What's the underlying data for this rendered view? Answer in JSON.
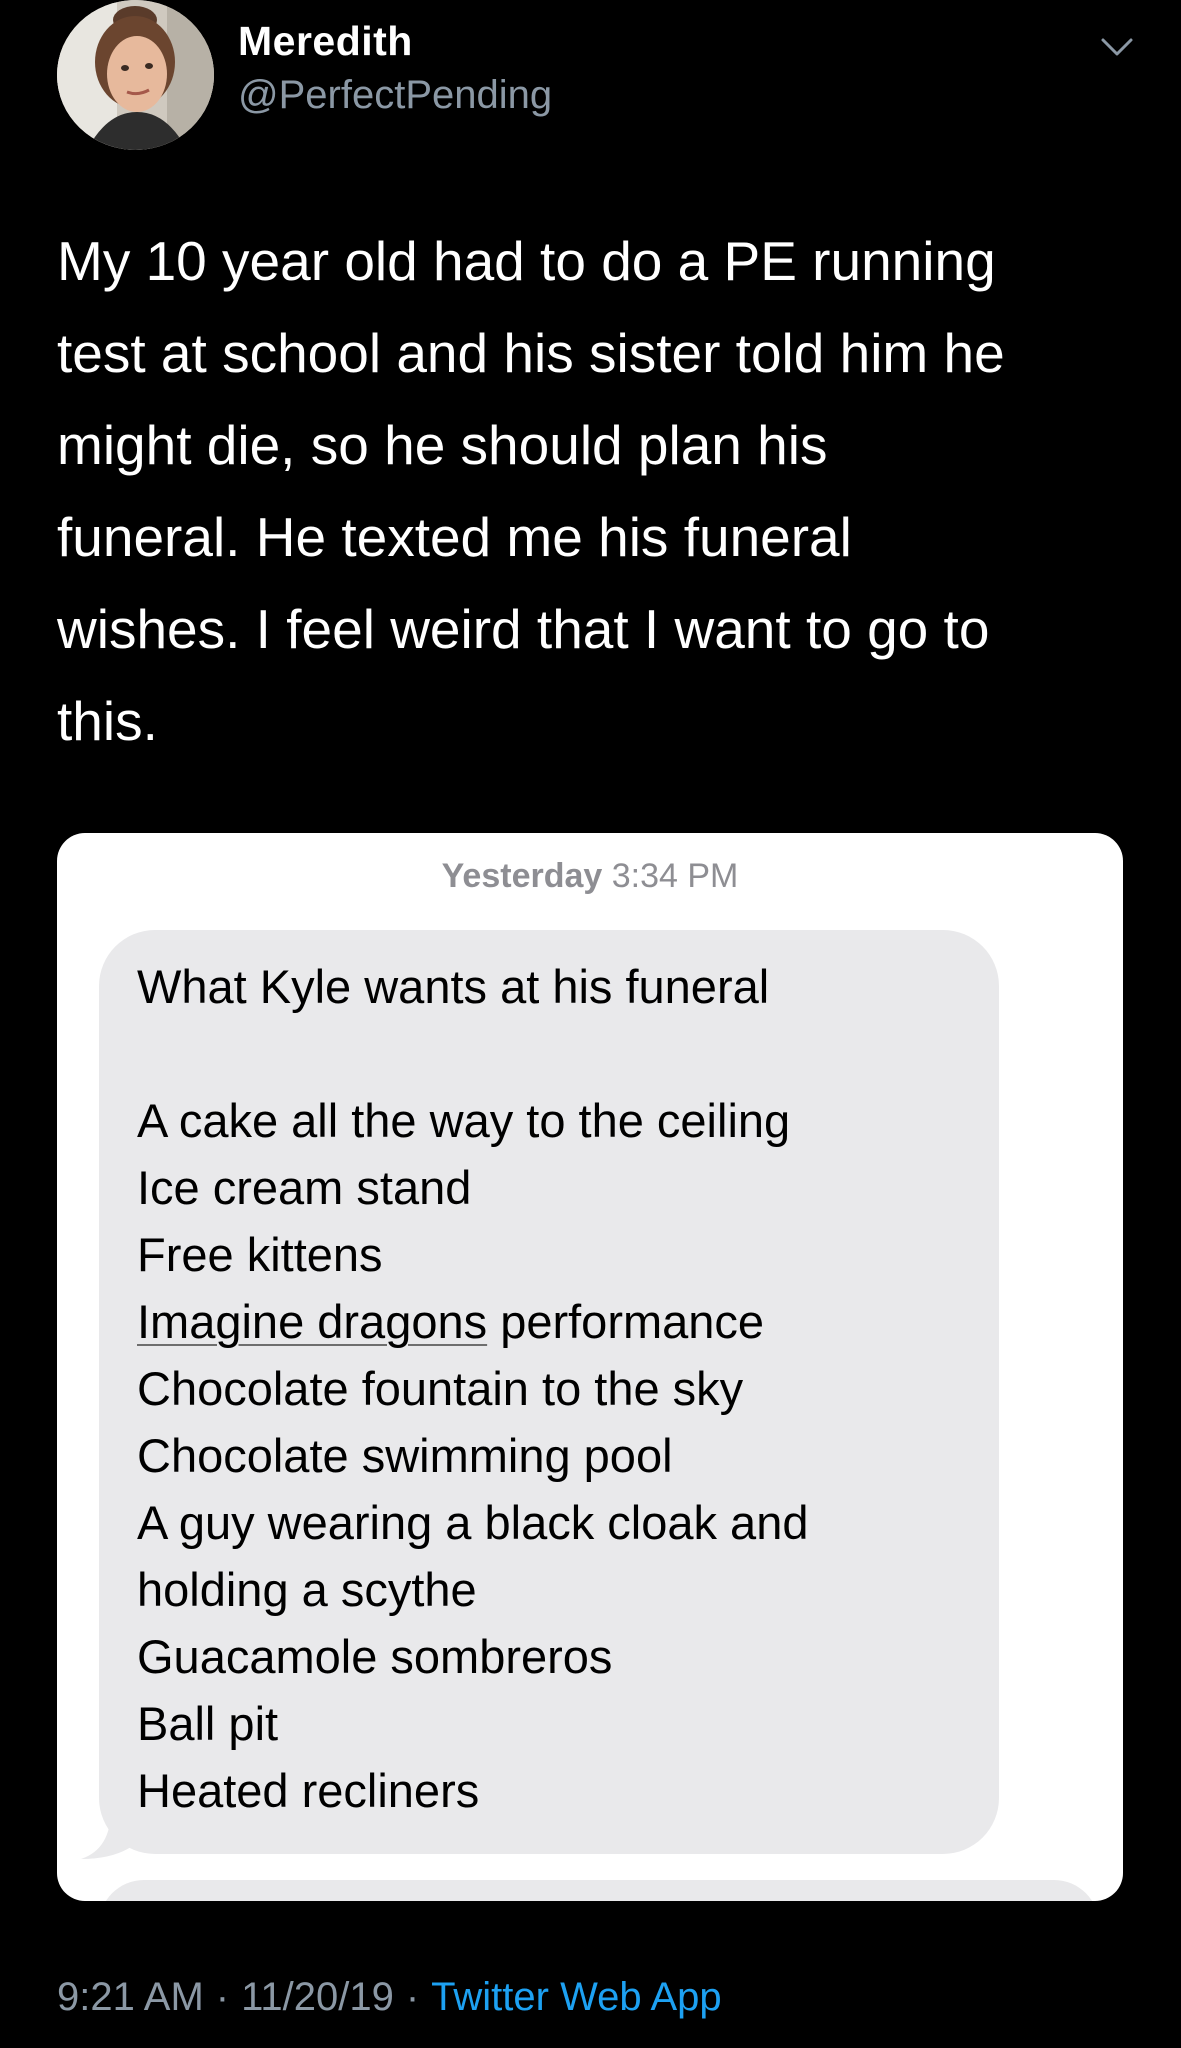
{
  "author": {
    "name": "Meredith",
    "handle": "@PerfectPending"
  },
  "tweet": {
    "text": "My 10 year old had to do a PE running\ntest at school and his sister told him he\nmight die, so he should plan his\nfuneral. He texted me his funeral\nwishes. I feel weird that I want to go to\nthis."
  },
  "message_screenshot": {
    "timestamp_day": "Yesterday",
    "timestamp_time": "3:34 PM",
    "title": "What Kyle wants at his funeral",
    "items": [
      "A cake all the way to the ceiling",
      "Ice cream stand",
      "Free kittens",
      "Imagine dragons",
      "performance",
      "Chocolate fountain to the sky",
      "Chocolate swimming pool",
      "A guy wearing a black cloak and",
      "holding a scythe",
      "Guacamole sombreros",
      "Ball pit",
      "Heated recliners"
    ]
  },
  "footer": {
    "time": "9:21 AM",
    "date": "11/20/19",
    "separator": "·",
    "app": "Twitter Web App"
  },
  "colors": {
    "background": "#000000",
    "text_primary": "#ffffff",
    "text_secondary": "#8b98a5",
    "link": "#1da1f2",
    "bubble": "#e9e9eb"
  },
  "icons": {
    "caret": "chevron-down-icon"
  }
}
